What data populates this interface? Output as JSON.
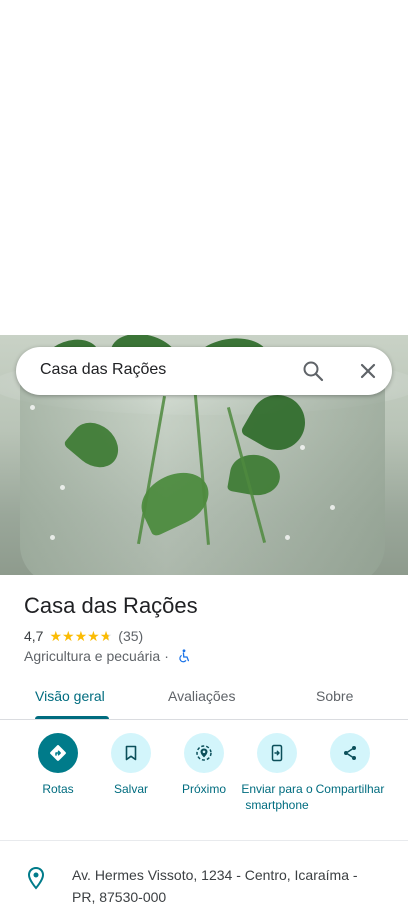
{
  "search": {
    "query": "Casa das Rações"
  },
  "place": {
    "name": "Casa das Rações",
    "rating": "4,7",
    "rating_value": 4.7,
    "reviews_count": "(35)",
    "category": "Agricultura e pecuária",
    "category_sep": "·"
  },
  "tabs": [
    {
      "label": "Visão geral",
      "active": true
    },
    {
      "label": "Avaliações",
      "active": false
    },
    {
      "label": "Sobre",
      "active": false
    }
  ],
  "actions": [
    {
      "label": "Rotas",
      "icon": "directions-icon"
    },
    {
      "label": "Salvar",
      "icon": "bookmark-icon"
    },
    {
      "label": "Próximo",
      "icon": "nearby-icon"
    },
    {
      "label": "Enviar para o smartphone",
      "icon": "send-to-phone-icon"
    },
    {
      "label": "Compartilhar",
      "icon": "share-icon"
    }
  ],
  "address": {
    "text": "Av. Hermes Vissoto, 1234 - Centro, Icaraíma - PR, 87530-000",
    "icon": "location-pin-icon"
  },
  "colors": {
    "accent": "#006c7f",
    "accent_fill": "#007b8a",
    "action_bg": "#d3f5fb",
    "star": "#fbbc04"
  }
}
